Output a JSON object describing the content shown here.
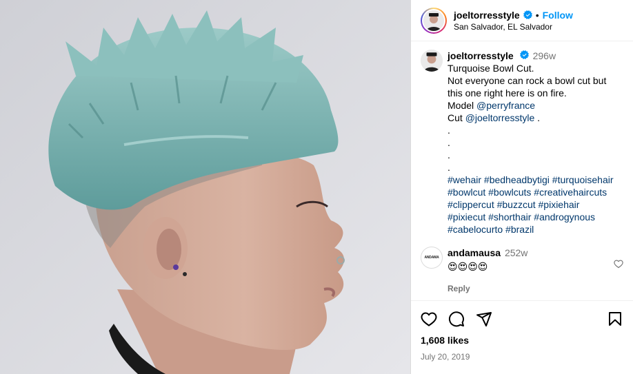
{
  "post": {
    "username": "joeltorresstyle",
    "follow_label": "Follow",
    "separator": "•",
    "location": "San Salvador, EL Salvador"
  },
  "caption": {
    "username": "joeltorresstyle",
    "time": "296w",
    "lines": [
      "Turquoise Bowl Cut.",
      "Not everyone can rock a bowl cut but",
      "this one right here is on fire."
    ],
    "model_label": "Model",
    "model_handle": "@perryfrance",
    "cut_label": "Cut",
    "cut_handle": "@joeltorresstyle",
    "cut_suffix": ".",
    "dots": [
      ".",
      ".",
      ".",
      "."
    ],
    "hashtag_lines": [
      "#wehair #bedheadbytigi #turquoisehair",
      "#bowlcut #bowlcuts #creativehaircuts",
      "#clippercut #buzzcut #pixiehair",
      "#pixiecut #shorthair #androgynous",
      "#cabelocurto #brazil"
    ]
  },
  "comment": {
    "avatar_text": "ANDAMA",
    "username": "andamausa",
    "time": "252w",
    "text": "😍😍😍😍",
    "reply_label": "Reply"
  },
  "footer": {
    "likes": "1,608 likes",
    "date": "July 20, 2019"
  },
  "icons": {
    "verified": "verified-badge-icon",
    "like": "heart-icon",
    "comment": "comment-bubble-icon",
    "share": "paper-plane-icon",
    "save": "bookmark-icon"
  },
  "colors": {
    "accent": "#0095f6",
    "link": "#00376b",
    "muted": "#737373",
    "hair": "#7fb7b5"
  }
}
